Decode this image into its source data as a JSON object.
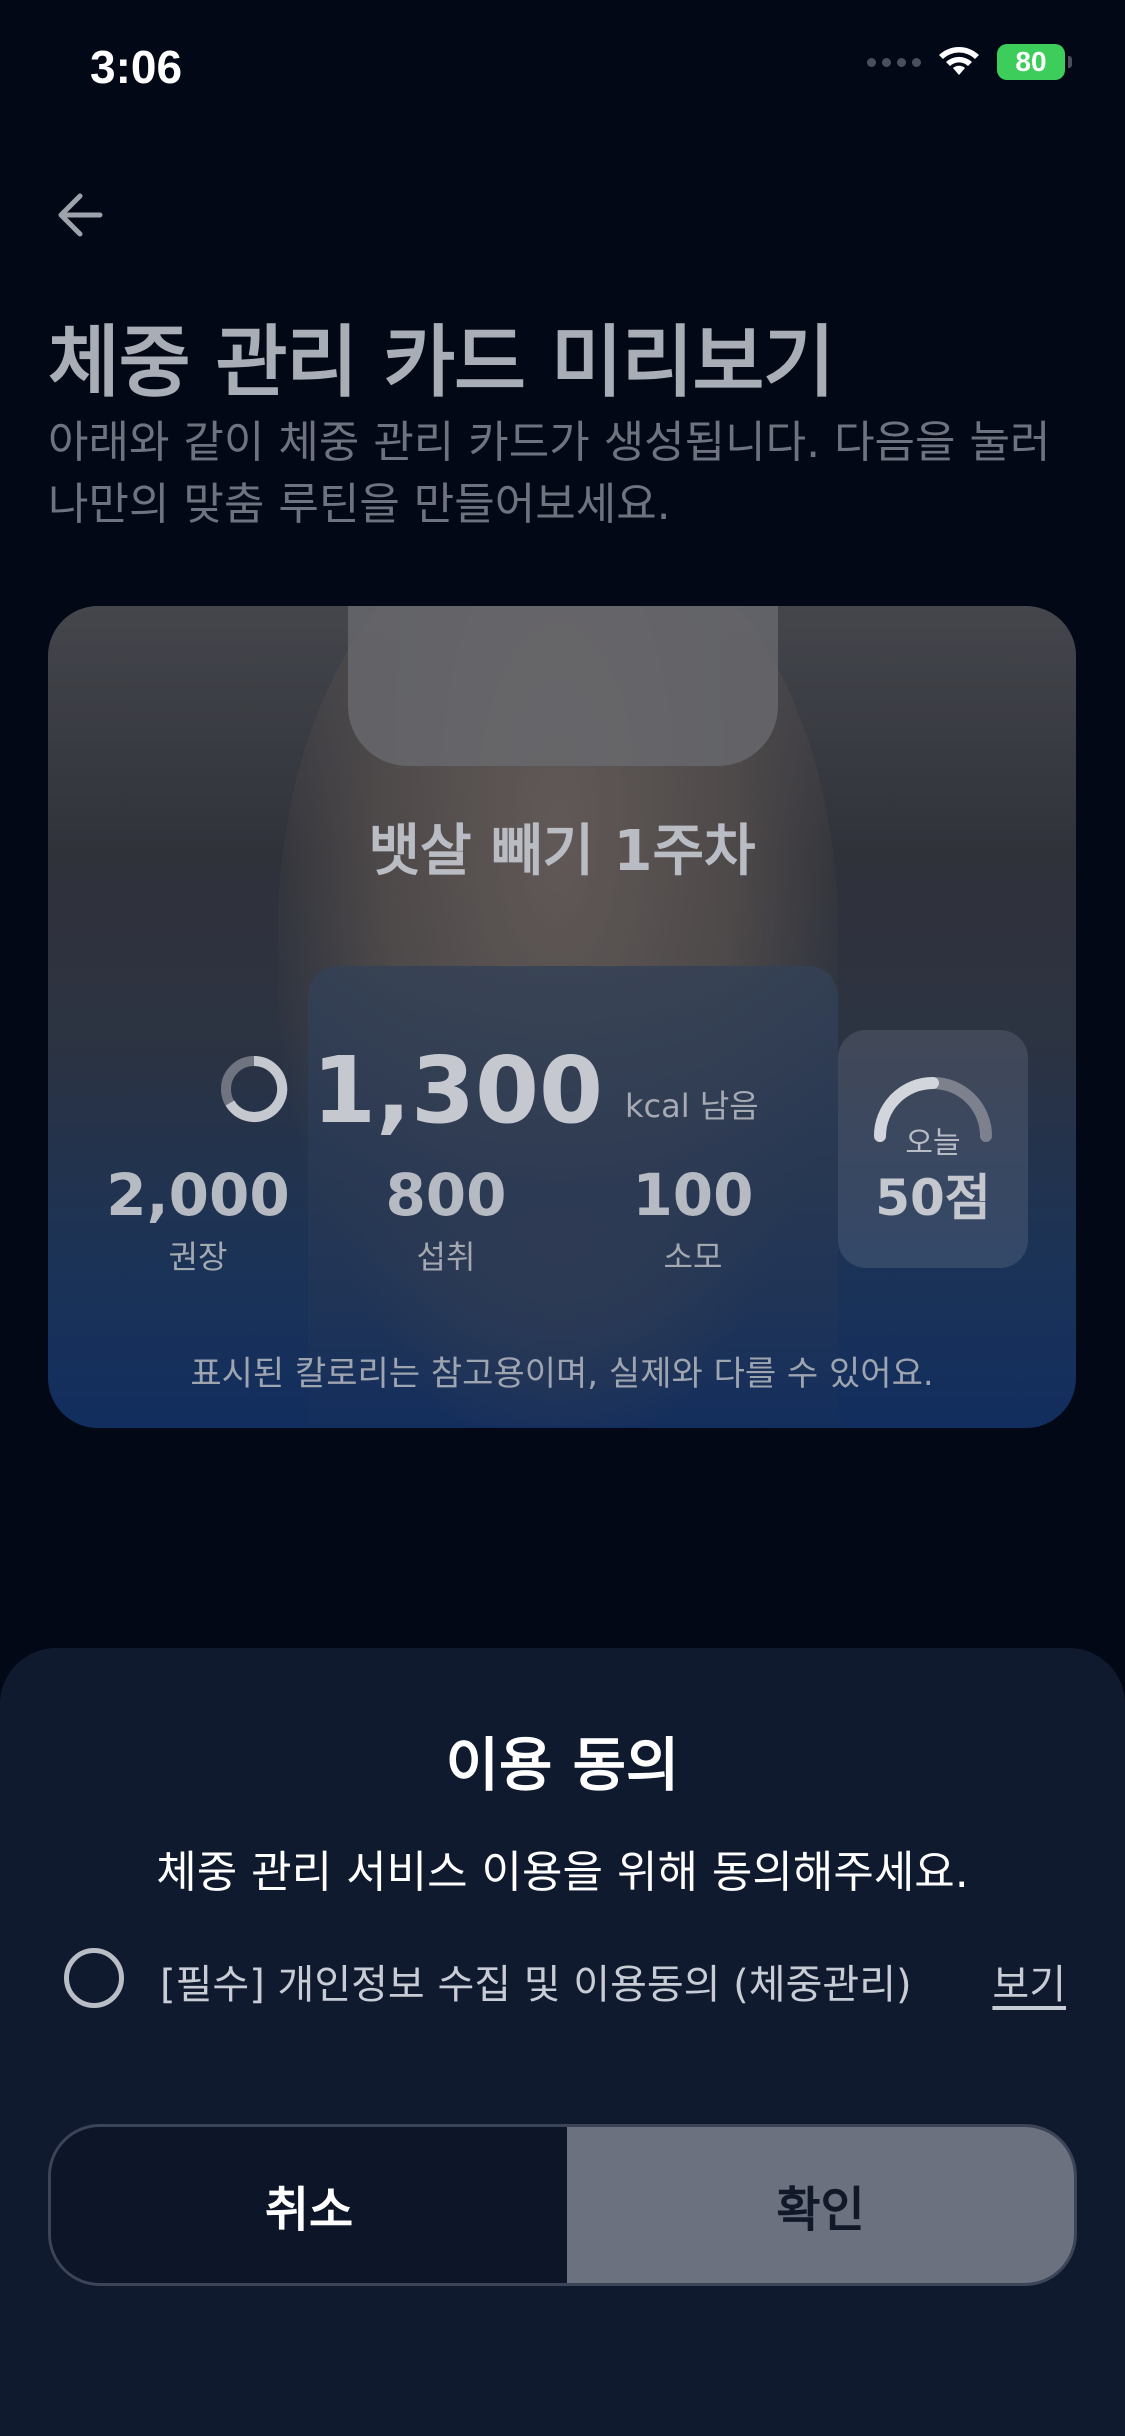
{
  "status_bar": {
    "time": "3:06",
    "battery": "80"
  },
  "header": {
    "title": "체중 관리 카드 미리보기",
    "description": "아래와 같이 체중 관리 카드가 생성됩니다. 다음을 눌러 나만의 맞춤 루틴을 만들어보세요."
  },
  "card": {
    "title": "뱃살 빼기 1주차",
    "kcal_remaining": "1,300",
    "kcal_unit": "kcal 남음",
    "stats": [
      {
        "value": "2,000",
        "label": "권장"
      },
      {
        "value": "800",
        "label": "섭취"
      },
      {
        "value": "100",
        "label": "소모"
      }
    ],
    "score": {
      "label": "오늘",
      "value": "50점"
    },
    "note": "표시된 칼로리는 참고용이며, 실제와 다를 수 있어요."
  },
  "sheet": {
    "title": "이용 동의",
    "description": "체중 관리 서비스 이용을 위해 동의해주세요.",
    "consent_text": "[필수] 개인정보 수집 및 이용동의 (체중관리)",
    "consent_view": "보기",
    "cancel_label": "취소",
    "confirm_label": "확인"
  },
  "colors": {
    "background": "#030816",
    "sheet": "#101a2f",
    "confirm_button": "#6b717f",
    "battery": "#3ccd5a"
  }
}
